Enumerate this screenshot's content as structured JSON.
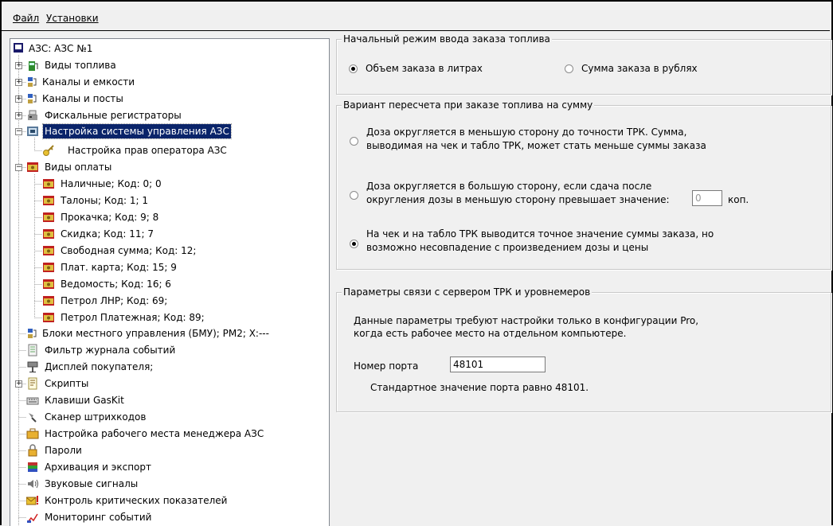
{
  "menu": {
    "file": "Файл",
    "settings": "Установки"
  },
  "tree": {
    "root": "АЗС: АЗС №1",
    "fuel_types": "Виды топлива",
    "channels_tanks": "Каналы и емкости",
    "channels_posts": "Каналы и посты",
    "fiscal": "Фискальные регистраторы",
    "control_system": "Настройка системы управления АЗС",
    "operator_rights": "Настройка прав оператора АЗС",
    "payment_types": "Виды оплаты",
    "payments": [
      "Наличные; Код: 0; 0",
      "Талоны; Код: 1; 1",
      "Прокачка; Код: 9; 8",
      "Скидка; Код: 11; 7",
      "Свободная сумма; Код: 12;",
      "Плат. карта; Код: 15; 9",
      "Ведомость; Код: 16; 6",
      "Петрол ЛНР; Код: 69;",
      "Петрол Платежная; Код: 89;"
    ],
    "local_control": "Блоки местного управления (БМУ);  РМ2;  X:---",
    "event_filter": "Фильтр журнала событий",
    "customer_display": "Дисплей покупателя;",
    "scripts": "Скрипты",
    "gaskit_keys": "Клавиши GasKit",
    "barcode": "Сканер штрихкодов",
    "manager_workplace": "Настройка рабочего места менеджера АЗС",
    "passwords": "Пароли",
    "archive": "Архивация и экспорт",
    "sounds": "Звуковые сигналы",
    "critical": "Контроль критических показателей",
    "monitoring": "Мониторинг событий"
  },
  "group1": {
    "title": "Начальный режим ввода заказа топлива",
    "opt_liters": "Объем заказа в литрах",
    "opt_rubles": "Сумма заказа в рублях",
    "selected": "opt_liters"
  },
  "group2": {
    "title": "Вариант пересчета при заказе топлива на сумму",
    "opt1_line1": "Доза округляется в меньшую сторону до точности ТРК. Сумма,",
    "opt1_line2": "выводимая на чек и табло ТРК, может стать меньше суммы заказа",
    "opt2_line1": "Доза округляется в большую сторону, если сдача после",
    "opt2_line2": "округления дозы в меньшую сторону превышает значение:",
    "kop_value": "0",
    "kop_label": "коп.",
    "opt3_line1": "На чек и на табло ТРК выводится точное значение суммы заказа, но",
    "opt3_line2": "возможно несовпадение с произведением дозы и цены",
    "selected": "opt3"
  },
  "group3": {
    "title": "Параметры связи с сервером ТРК и уровнемеров",
    "desc_line1": "Данные параметры требуют настройки только в конфигурации Pro,",
    "desc_line2": "когда есть рабочее место на отдельном компьютере.",
    "port_label": "Номер порта",
    "port_value": "48101",
    "port_hint": "Стандартное значение порта равно 48101."
  },
  "colors": {
    "selection": "#0a246a",
    "window_bg": "#f0f0f0",
    "tree_bg": "#ffffff"
  }
}
